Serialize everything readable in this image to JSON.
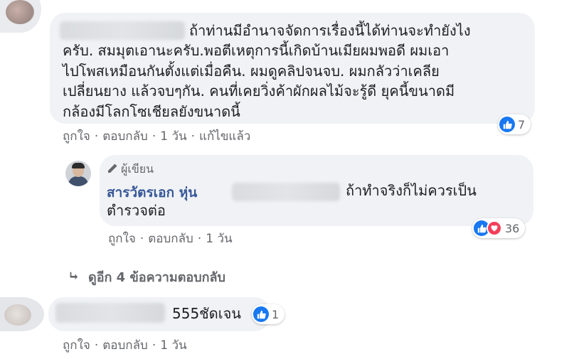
{
  "comment1": {
    "line1": "ถ้าท่านมีอำนาจจัดการเรื่องนี้ได้ท่านจะทำยังไง",
    "lines": [
      "ครับ. สมมุตเอานะครับ.พอตีเหตุการนี้เกิดบ้านเมียผมพอดี ผมเอา",
      "ไปโพสเหมือนกันตั้งแต่เมื่อคืน. ผมดูคลิปจนจบ. ผมกลัวว่าเคลีย",
      "เปลี่ยนยาง แล้วจบๆกัน. คนที่เคยวิ่งค้าผักผลไม้จะรู้ดี ยุคนี้ขนาดมี",
      "กล้องมีโลกโซเชียลยังขนาดนี้"
    ],
    "like": "ถูกใจ",
    "reply": "ตอบกลับ",
    "time": "1 วัน",
    "edited": "แก้ไขแล้ว",
    "reaction_count": "7",
    "sep": "·"
  },
  "comment2": {
    "badge": "ผู้เขียน",
    "author": "สารวัตรเอก หุ่น",
    "line1": "ถ้าทำจริงก็ไม่ควรเป็น",
    "line2": "ตำรวจต่อ",
    "like": "ถูกใจ",
    "reply": "ตอบกลับ",
    "time": "1 วัน",
    "reaction_count": "36",
    "sep": "·"
  },
  "more_replies": "ดูอีก 4 ข้อความตอบกลับ",
  "comment3": {
    "text": "555ชัดเจน",
    "like": "ถูกใจ",
    "reply": "ตอบกลับ",
    "time": "1 วัน",
    "reaction_count": "1",
    "sep": "·"
  },
  "colors": {
    "like_blue": "#1877f2",
    "love_red": "#f33e58",
    "author_link": "#385898",
    "bubble": "#f0f2f5"
  }
}
